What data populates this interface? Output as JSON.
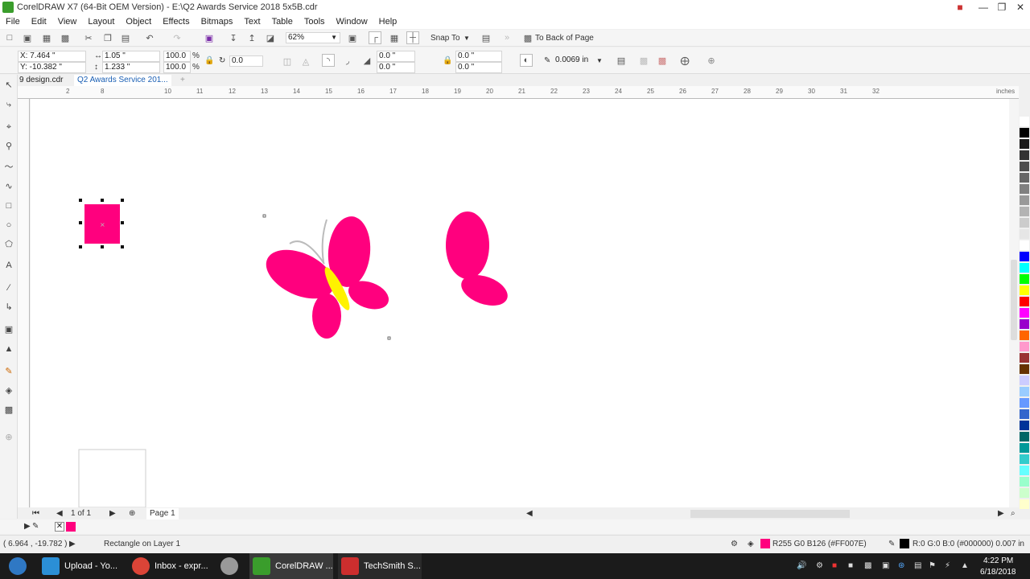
{
  "window": {
    "title": "CorelDRAW X7 (64-Bit OEM Version) - E:\\Q2 Awards Service 2018 5x5B.cdr"
  },
  "menu": [
    "File",
    "Edit",
    "View",
    "Layout",
    "Object",
    "Effects",
    "Bitmaps",
    "Text",
    "Table",
    "Tools",
    "Window",
    "Help"
  ],
  "standard_toolbar": {
    "zoom": "62%",
    "snap_to": "Snap To",
    "to_back": "To Back of Page"
  },
  "property_bar": {
    "x": "X: 7.464 \"",
    "y": "Y: -10.382 \"",
    "width": "1.05 \"",
    "height": "1.233 \"",
    "scale_x": "100.0",
    "scale_y": "100.0",
    "pct": "%",
    "rotation": "0.0",
    "corner1": "0.0 \"",
    "corner2": "0.0 \"",
    "corner3": "0.0 \"",
    "corner4": "0.0 \"",
    "outline_width": "0.0069 in"
  },
  "tabs": [
    "9 design.cdr",
    "Q2 Awards Service 201..."
  ],
  "ruler": {
    "h_ticks": [
      "2",
      "8",
      "10",
      "11",
      "12",
      "13",
      "14",
      "15",
      "16",
      "17",
      "18",
      "19",
      "20",
      "21",
      "22",
      "23",
      "24",
      "25",
      "26",
      "27",
      "28",
      "29",
      "30",
      "31",
      "32"
    ],
    "unit": "inches"
  },
  "page_nav": {
    "page_count": "1 of 1",
    "page_tab": "Page 1"
  },
  "status": {
    "cursor": "( 6.964 , -19.782 )",
    "object": "Rectangle on Layer 1",
    "fill": "R255 G0 B126 (#FF007E)",
    "outline": "R:0 G:0 B:0 (#000000)  0.007 in"
  },
  "taskbar": {
    "items": [
      "Upload - Yo...",
      "Inbox - expr...",
      "CorelDRAW ...",
      "TechSmith S..."
    ],
    "time": "4:22 PM",
    "date": "6/18/2018"
  },
  "colors": {
    "pink": "#FF007E",
    "yellow": "#FFF200",
    "palette": [
      "#ffffff",
      "#000000",
      "#1a1a1a",
      "#333333",
      "#4d4d4d",
      "#666666",
      "#808080",
      "#999999",
      "#b3b3b3",
      "#cccccc",
      "#e6e6e6",
      "#ffffff",
      "#0000ff",
      "#00ffff",
      "#00ff00",
      "#ffff00",
      "#ff0000",
      "#ff00ff",
      "#9900cc",
      "#ff6600",
      "#ff99cc",
      "#993333",
      "#663300",
      "#ccccff",
      "#99ccff",
      "#6699ff",
      "#3366cc",
      "#003399",
      "#006666",
      "#009999",
      "#33cccc",
      "#66ffff",
      "#99ffcc",
      "#ccffcc",
      "#ffffcc"
    ]
  }
}
